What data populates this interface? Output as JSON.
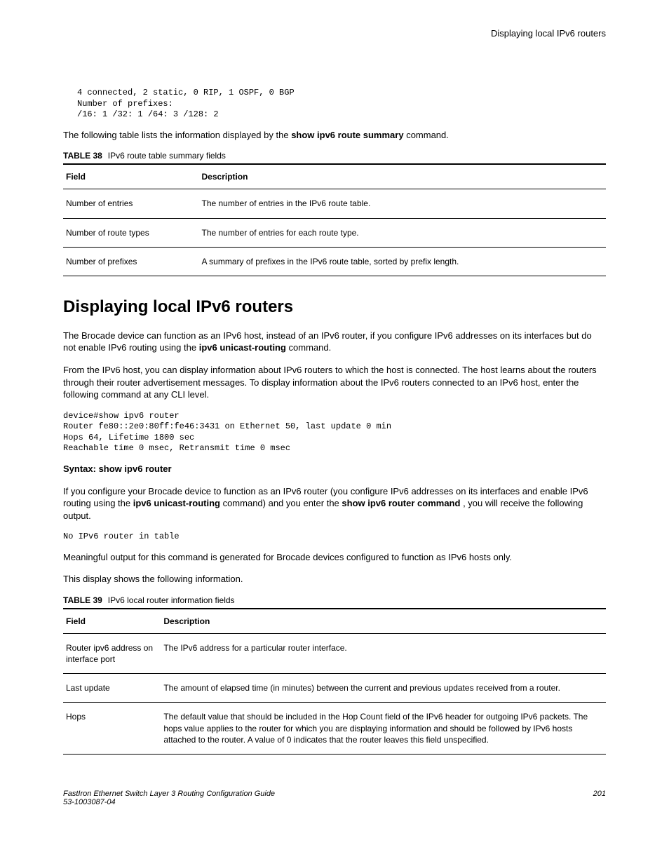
{
  "header": {
    "title": "Displaying local IPv6 routers"
  },
  "code1": "4 connected, 2 static, 0 RIP, 1 OSPF, 0 BGP\nNumber of prefixes:\n/16: 1 /32: 1 /64: 3 /128: 2",
  "para1_a": "The following table lists the information displayed by the ",
  "para1_b": "show ipv6 route summary",
  "para1_c": " command.",
  "table38": {
    "label": "TABLE 38",
    "caption": "IPv6 route table summary fields",
    "head_field": "Field",
    "head_desc": "Description",
    "rows": [
      {
        "field": "Number of entries",
        "desc": "The number of entries in the IPv6 route table."
      },
      {
        "field": "Number of route types",
        "desc": "The number of entries for each route type."
      },
      {
        "field": "Number of prefixes",
        "desc": "A summary of prefixes in the IPv6 route table, sorted by prefix length."
      }
    ]
  },
  "section_heading": "Displaying local IPv6 routers",
  "para2_a": "The Brocade device can function as an IPv6 host, instead of an IPv6 router, if you configure IPv6 addresses on its interfaces but do not enable IPv6 routing using the ",
  "para2_b": "ipv6 unicast-routing",
  "para2_c": " command.",
  "para3": "From the IPv6 host, you can display information about IPv6 routers to which the host is connected. The host learns about the routers through their router advertisement messages. To display information about the IPv6 routers connected to an IPv6 host, enter the following command at any CLI level.",
  "code2": "device#show ipv6 router\nRouter fe80::2e0:80ff:fe46:3431 on Ethernet 50, last update 0 min\nHops 64, Lifetime 1800 sec\nReachable time 0 msec, Retransmit time 0 msec",
  "syntax": "Syntax: show ipv6 router",
  "para4_a": "If you configure your Brocade device to function as an IPv6 router (you configure IPv6 addresses on its interfaces and enable IPv6 routing using the ",
  "para4_b": "ipv6 unicast-routing",
  "para4_c": " command) and you enter the ",
  "para4_d": "show ipv6 router command",
  "para4_e": " , you will receive the following output.",
  "code3": "No IPv6 router in table",
  "para5": "Meaningful output for this command is generated for Brocade devices configured to function as IPv6 hosts only.",
  "para6": "This display shows the following information.",
  "table39": {
    "label": "TABLE 39",
    "caption": "IPv6 local router information fields",
    "head_field": "Field",
    "head_desc": "Description",
    "rows": [
      {
        "field": "Router ipv6 address on interface port",
        "desc": "The IPv6 address for a particular router interface."
      },
      {
        "field": "Last update",
        "desc": "The amount of elapsed time (in minutes) between the current and previous updates received from a router."
      },
      {
        "field": "Hops",
        "desc": "The default value that should be included in the Hop Count field of the IPv6 header for outgoing IPv6 packets. The hops value applies to the router for which you are displaying information and should be followed by IPv6 hosts attached to the router. A value of 0 indicates that the router leaves this field unspecified."
      }
    ]
  },
  "footer": {
    "left1": "FastIron Ethernet Switch Layer 3 Routing Configuration Guide",
    "left2": "53-1003087-04",
    "page": "201"
  }
}
